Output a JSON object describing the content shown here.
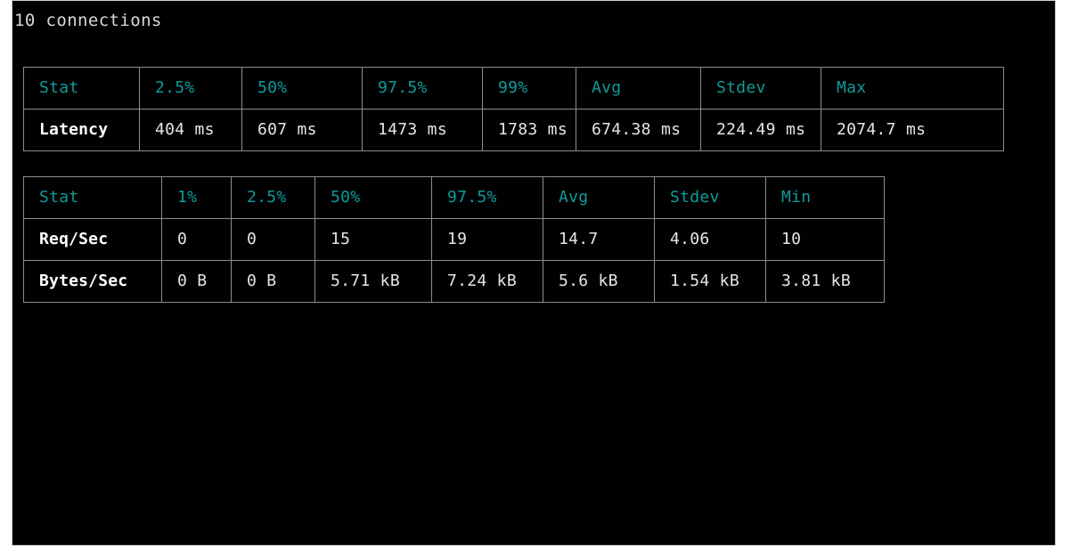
{
  "terminal": {
    "status_line": "10 connections",
    "background_color": "#000000",
    "header_color": "#0f9b9b",
    "value_color": "#e6e6e6",
    "label_color": "#ffffff",
    "border_color": "#8d8d8d"
  },
  "latency_table": {
    "name": "latency",
    "columns": [
      "Stat",
      "2.5%",
      "50%",
      "97.5%",
      "99%",
      "Avg",
      "Stdev",
      "Max"
    ],
    "rows": [
      {
        "label": "Latency",
        "values": [
          "404 ms",
          "607 ms",
          "1473 ms",
          "1783 ms",
          "674.38 ms",
          "224.49 ms",
          "2074.7 ms"
        ]
      }
    ]
  },
  "throughput_table": {
    "name": "throughput",
    "columns": [
      "Stat",
      "1%",
      "2.5%",
      "50%",
      "97.5%",
      "Avg",
      "Stdev",
      "Min"
    ],
    "rows": [
      {
        "label": "Req/Sec",
        "values": [
          "0",
          "0",
          "15",
          "19",
          "14.7",
          "4.06",
          "10"
        ]
      },
      {
        "label": "Bytes/Sec",
        "values": [
          "0 B",
          "0 B",
          "5.71 kB",
          "7.24 kB",
          "5.6 kB",
          "1.54 kB",
          "3.81 kB"
        ]
      }
    ]
  }
}
